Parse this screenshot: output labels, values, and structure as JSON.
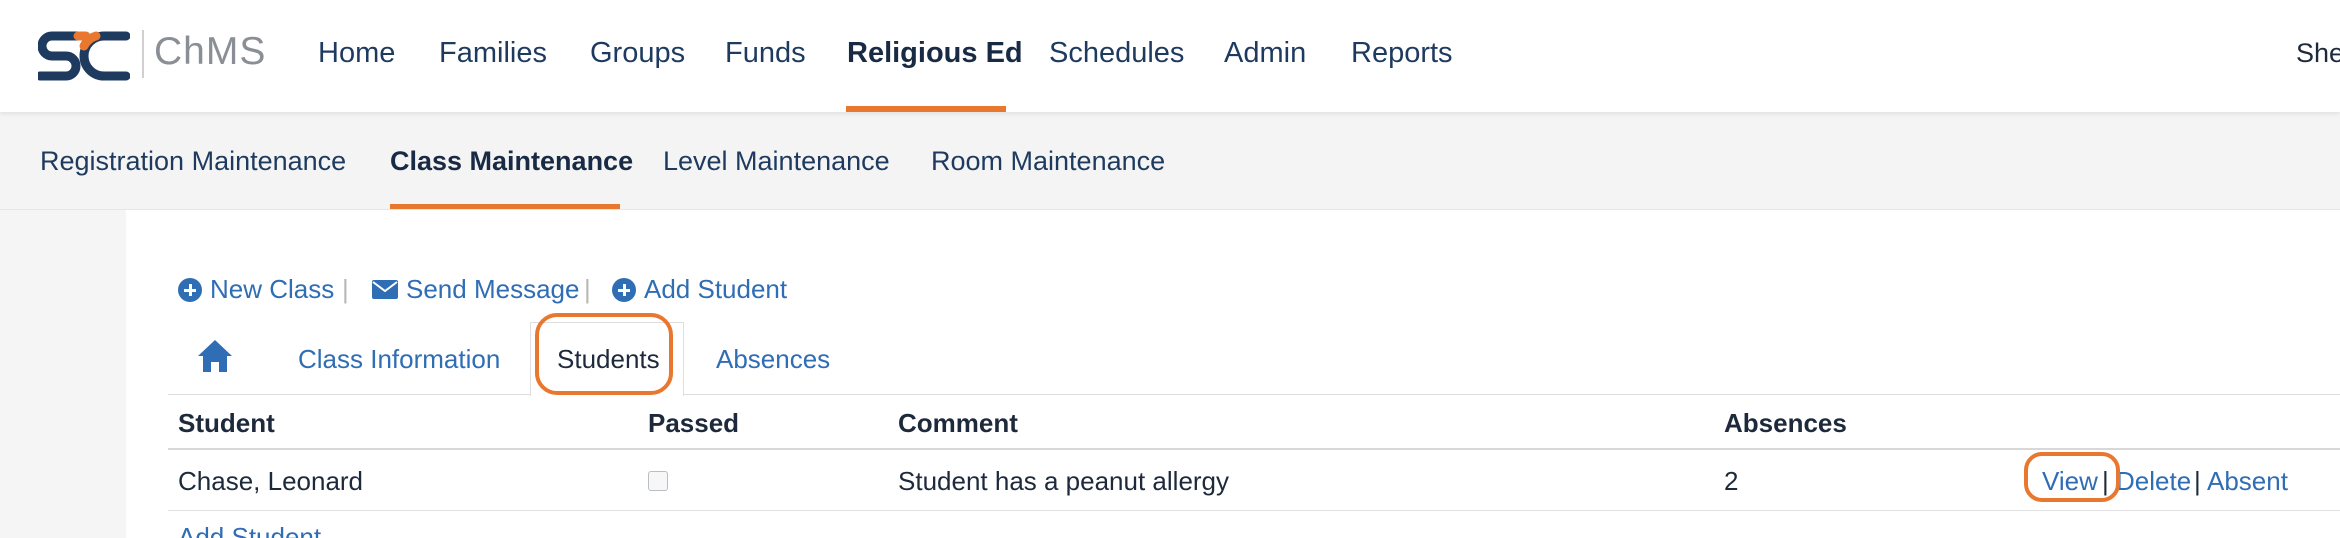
{
  "brand": {
    "name": "ChMS",
    "accent": "#E87830",
    "navy": "#1E3A5F"
  },
  "nav": {
    "items": [
      "Home",
      "Families",
      "Groups",
      "Funds",
      "Religious Ed",
      "Schedules",
      "Admin",
      "Reports"
    ],
    "active": "Religious Ed",
    "user": "Shel"
  },
  "subnav": {
    "items": [
      "Registration Maintenance",
      "Class Maintenance",
      "Level Maintenance",
      "Room Maintenance"
    ],
    "active": "Class Maintenance"
  },
  "toolbar": {
    "new_class": "New Class",
    "send_message": "Send Message",
    "add_student": "Add Student",
    "separator": "|"
  },
  "tabs": {
    "home_icon": "home-icon",
    "items": [
      "Class Information",
      "Students",
      "Absences"
    ],
    "active": "Students"
  },
  "table": {
    "columns": [
      "Student",
      "Passed",
      "Comment",
      "Absences"
    ],
    "rows": [
      {
        "student": "Chase, Leonard",
        "passed": false,
        "comment": "Student has a peanut allergy",
        "absences": "2",
        "actions": [
          "View",
          "Delete",
          "Absent"
        ]
      }
    ],
    "action_separator": "|",
    "add_link": "Add Student"
  }
}
